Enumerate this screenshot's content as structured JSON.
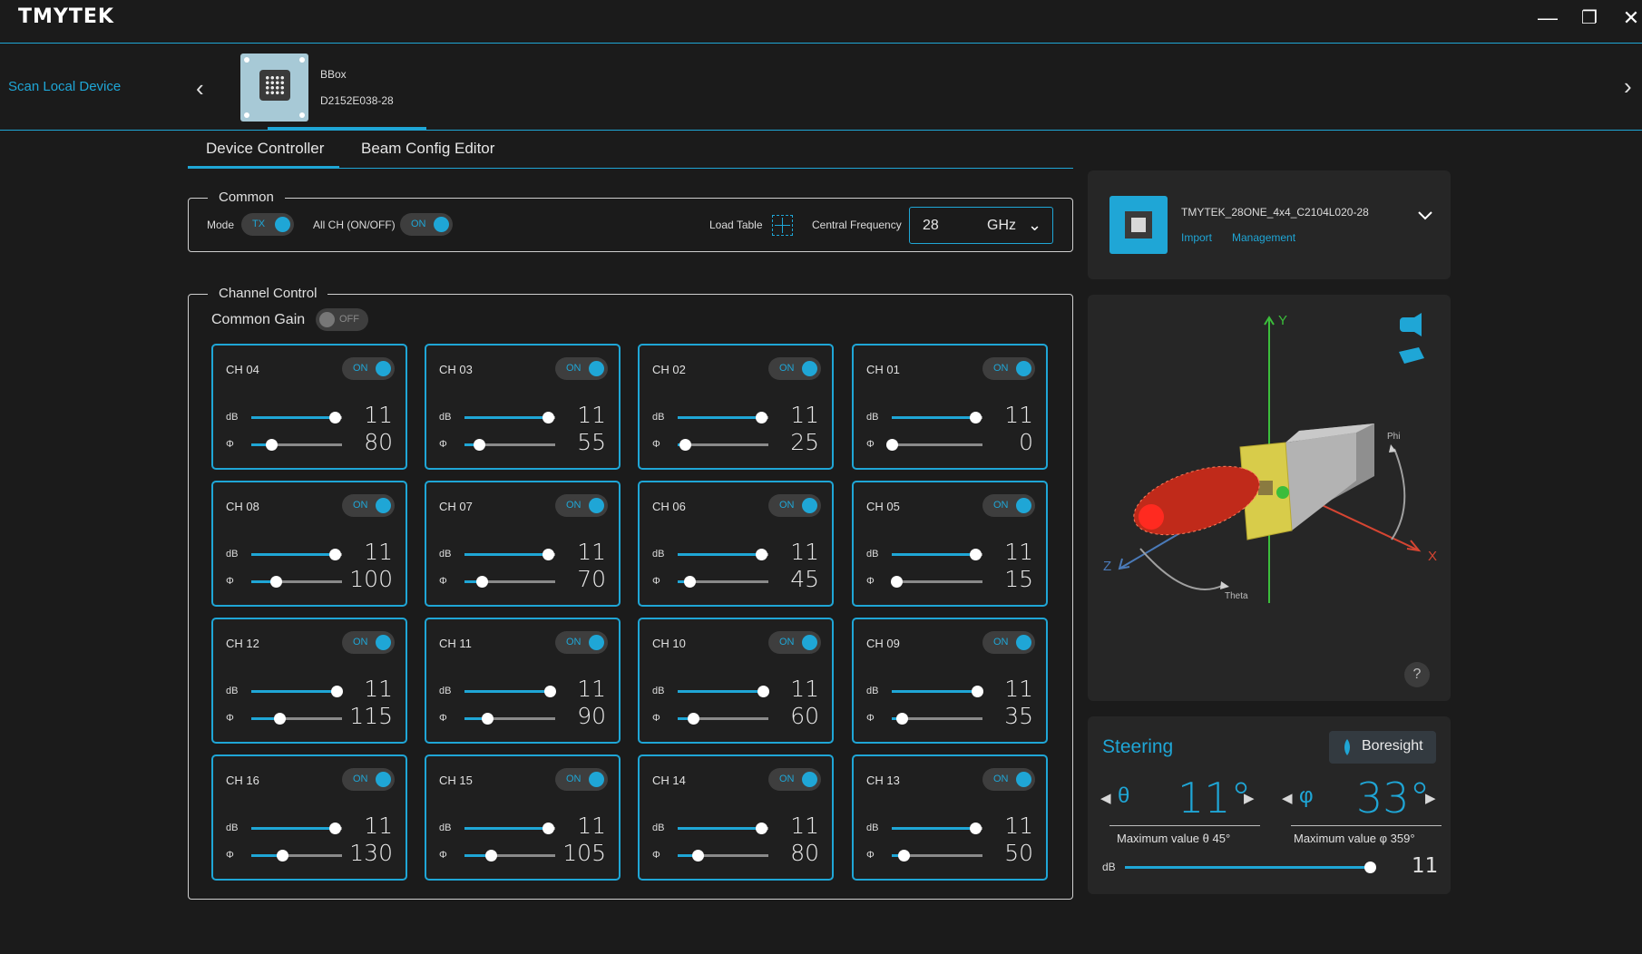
{
  "app": {
    "logo": "TMYTEK",
    "minimize": "—",
    "restore": "❐",
    "close": "✕"
  },
  "devicebar": {
    "scan_label": "Scan Local Device",
    "prev": "‹",
    "next": "›",
    "device_name": "BBox",
    "device_serial": "D2152E038-28"
  },
  "tabs": [
    {
      "label": "Device Controller",
      "active": true
    },
    {
      "label": "Beam Config Editor",
      "active": false
    }
  ],
  "common": {
    "legend": "Common",
    "mode_label": "Mode",
    "mode_value": "TX",
    "allch_label": "All CH (ON/OFF)",
    "allch_value": "ON",
    "load_table_label": "Load Table",
    "central_freq_label": "Central Frequency",
    "freq_value": "28",
    "freq_unit": "GHz"
  },
  "channel_control": {
    "legend": "Channel Control",
    "common_gain_label": "Common Gain",
    "common_gain_value": "OFF",
    "db_label": "dB",
    "phase_label": "Φ",
    "channels": [
      {
        "name": "CH 04",
        "state": "ON",
        "db": "11",
        "phase": "80",
        "db_frac": 0.92,
        "phase_frac": 0.22
      },
      {
        "name": "CH 03",
        "state": "ON",
        "db": "11",
        "phase": "55",
        "db_frac": 0.92,
        "phase_frac": 0.16
      },
      {
        "name": "CH 02",
        "state": "ON",
        "db": "11",
        "phase": "25",
        "db_frac": 0.92,
        "phase_frac": 0.08
      },
      {
        "name": "CH 01",
        "state": "ON",
        "db": "11",
        "phase": "0",
        "db_frac": 0.92,
        "phase_frac": 0.0
      },
      {
        "name": "CH 08",
        "state": "ON",
        "db": "11",
        "phase": "100",
        "db_frac": 0.92,
        "phase_frac": 0.27
      },
      {
        "name": "CH 07",
        "state": "ON",
        "db": "11",
        "phase": "70",
        "db_frac": 0.92,
        "phase_frac": 0.19
      },
      {
        "name": "CH 06",
        "state": "ON",
        "db": "11",
        "phase": "45",
        "db_frac": 0.92,
        "phase_frac": 0.13
      },
      {
        "name": "CH 05",
        "state": "ON",
        "db": "11",
        "phase": "15",
        "db_frac": 0.92,
        "phase_frac": 0.05
      },
      {
        "name": "CH 12",
        "state": "ON",
        "db": "11",
        "phase": "115",
        "db_frac": 0.94,
        "phase_frac": 0.31
      },
      {
        "name": "CH 11",
        "state": "ON",
        "db": "11",
        "phase": "90",
        "db_frac": 0.94,
        "phase_frac": 0.25
      },
      {
        "name": "CH 10",
        "state": "ON",
        "db": "11",
        "phase": "60",
        "db_frac": 0.94,
        "phase_frac": 0.17
      },
      {
        "name": "CH 09",
        "state": "ON",
        "db": "11",
        "phase": "35",
        "db_frac": 0.94,
        "phase_frac": 0.11
      },
      {
        "name": "CH 16",
        "state": "ON",
        "db": "11",
        "phase": "130",
        "db_frac": 0.92,
        "phase_frac": 0.34
      },
      {
        "name": "CH 15",
        "state": "ON",
        "db": "11",
        "phase": "105",
        "db_frac": 0.92,
        "phase_frac": 0.29
      },
      {
        "name": "CH 14",
        "state": "ON",
        "db": "11",
        "phase": "80",
        "db_frac": 0.92,
        "phase_frac": 0.22
      },
      {
        "name": "CH 13",
        "state": "ON",
        "db": "11",
        "phase": "50",
        "db_frac": 0.92,
        "phase_frac": 0.13
      }
    ]
  },
  "beam_config": {
    "name": "TMYTEK_28ONE_4x4_C2104L020-28",
    "import": "Import",
    "management": "Management",
    "chevron": "⌄"
  },
  "viewer": {
    "axis_y": "Y",
    "axis_x": "X",
    "axis_z": "Z",
    "phi": "Phi",
    "theta": "Theta",
    "help": "?"
  },
  "steering": {
    "title": "Steering",
    "boresight_label": "Boresight",
    "theta_symbol": "θ",
    "theta_value": "11°",
    "theta_max": "Maximum value θ 45°",
    "phi_symbol": "φ",
    "phi_value": "33°",
    "phi_max": "Maximum value φ 359°",
    "db_label": "dB",
    "db_value": "11",
    "db_frac": 0.98,
    "left_arrow": "◀",
    "right_arrow": "▶"
  },
  "colors": {
    "accent": "#1fa6d6",
    "background": "#1b1b1b",
    "panel": "#262626"
  }
}
